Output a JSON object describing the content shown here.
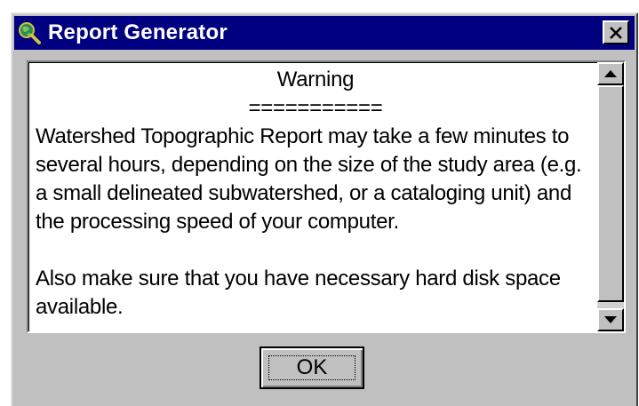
{
  "window": {
    "title": "Report Generator",
    "icon": "globe-magnifier-icon",
    "close_icon": "close-icon"
  },
  "message": {
    "heading": "Warning",
    "underline": "===========",
    "paragraph1": "Watershed Topographic Report may take a few minutes to several hours, depending on the size of the study area (e.g. a small delineated subwatershed, or a cataloging unit) and the processing speed of your computer.",
    "paragraph2": "Also make sure that you have necessary hard disk space available."
  },
  "scrollbar": {
    "up_icon": "arrow-up-icon",
    "down_icon": "arrow-down-icon"
  },
  "buttons": {
    "ok_label": "OK"
  },
  "colors": {
    "titlebar": "#000080",
    "face": "#c0c0c0",
    "title_text": "#ffffff"
  }
}
